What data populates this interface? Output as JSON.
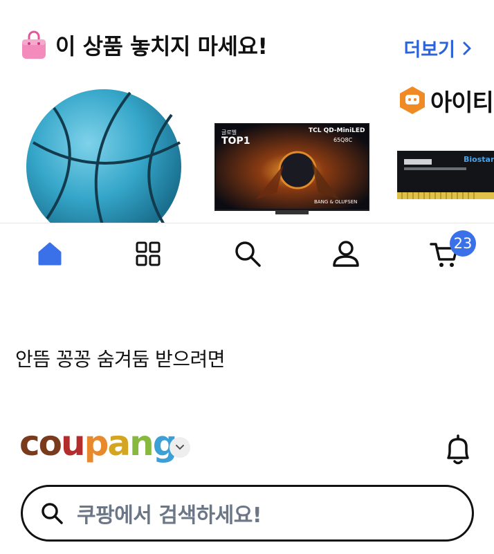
{
  "rec": {
    "title": "이 상품 놓치지 마세요!",
    "more_label": "더보기",
    "partner_logo_text": "아이티"
  },
  "products": [
    {
      "name": "blue basketball"
    },
    {
      "name": "TCL QD-Mini LED TV"
    },
    {
      "name": "Biostar RAM"
    }
  ],
  "tv_labels": {
    "brand": "TCL QD-MiniLED",
    "model": "65Q8C",
    "top": "TOP1",
    "global": "글로벌",
    "audio": "BANG & OLUFSEN"
  },
  "ram_label": "Biostar",
  "nav": {
    "items": [
      "home",
      "category",
      "search",
      "my",
      "cart"
    ],
    "cart_count": "23",
    "active_color": "#3a71e8"
  },
  "tagline": "안뜸 꽁꽁 숨겨둠 받으려면",
  "coupang": {
    "logo_letters": [
      "c",
      "o",
      "u",
      "p",
      "a",
      "n",
      "g"
    ],
    "logo_colors": [
      "#7a3b1c",
      "#7a3b1c",
      "#b32d2d",
      "#e8892c",
      "#d4a521",
      "#87b941",
      "#3c9fd6"
    ]
  },
  "search": {
    "placeholder": "쿠팡에서 검색하세요!"
  }
}
